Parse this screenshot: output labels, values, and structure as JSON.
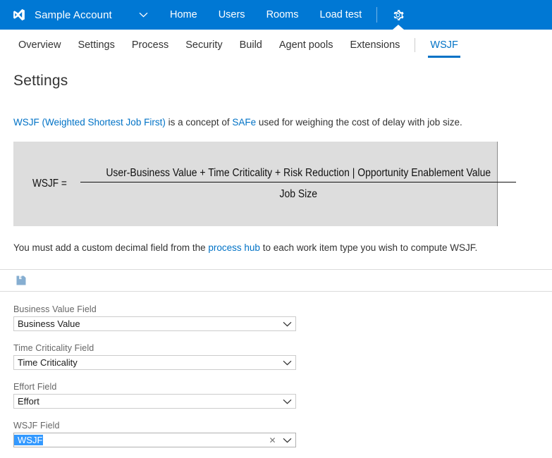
{
  "topbar": {
    "logo_icon": "visual-studio-logo-icon",
    "account_name": "Sample Account",
    "account_chevron_icon": "chevron-down-icon",
    "nav_items": [
      {
        "label": "Home"
      },
      {
        "label": "Users"
      },
      {
        "label": "Rooms"
      },
      {
        "label": "Load test"
      }
    ],
    "gear_icon": "gear-icon",
    "accent_color": "#0078d4"
  },
  "subnav": {
    "items": [
      {
        "label": "Overview",
        "active": false
      },
      {
        "label": "Settings",
        "active": false
      },
      {
        "label": "Process",
        "active": false
      },
      {
        "label": "Security",
        "active": false
      },
      {
        "label": "Build",
        "active": false
      },
      {
        "label": "Agent pools",
        "active": false
      },
      {
        "label": "Extensions",
        "active": false
      }
    ],
    "separated_item": {
      "label": "WSJF",
      "active": true
    },
    "active_color": "#0072c6"
  },
  "main": {
    "page_title": "Settings",
    "intro": {
      "link1": "WSJF (Weighted Shortest Job First)",
      "mid": " is a concept of ",
      "link2": "SAFe",
      "tail": " used for weighing the cost of delay with job size."
    },
    "formula": {
      "lhs": "WSJF =",
      "numerator": "User-Business Value + Time Criticality  + Risk Reduction | Opportunity Enablement Value",
      "denominator": "Job Size",
      "background_color": "#dddddd"
    },
    "note": {
      "lead": "You must add a custom decimal field from the ",
      "link": "process hub",
      "tail": " to each work item type you wish to compute WSJF."
    },
    "toolbar": {
      "save_icon": "save-floppy-disk-icon",
      "save_title": "Save"
    },
    "fields": [
      {
        "label": "Business Value Field",
        "value": "Business Value",
        "focused": false,
        "has_clear": false,
        "chevron_icon": "chevron-down-icon"
      },
      {
        "label": "Time Criticality Field",
        "value": "Time Criticality",
        "focused": false,
        "has_clear": false,
        "chevron_icon": "chevron-down-icon"
      },
      {
        "label": "Effort Field",
        "value": "Effort",
        "focused": false,
        "has_clear": false,
        "chevron_icon": "chevron-down-icon"
      },
      {
        "label": "WSJF Field",
        "value": "WSJF",
        "focused": true,
        "has_clear": true,
        "clear_icon": "close-x-icon",
        "chevron_icon": "chevron-down-icon",
        "selection_color": "#3399ff"
      }
    ]
  }
}
